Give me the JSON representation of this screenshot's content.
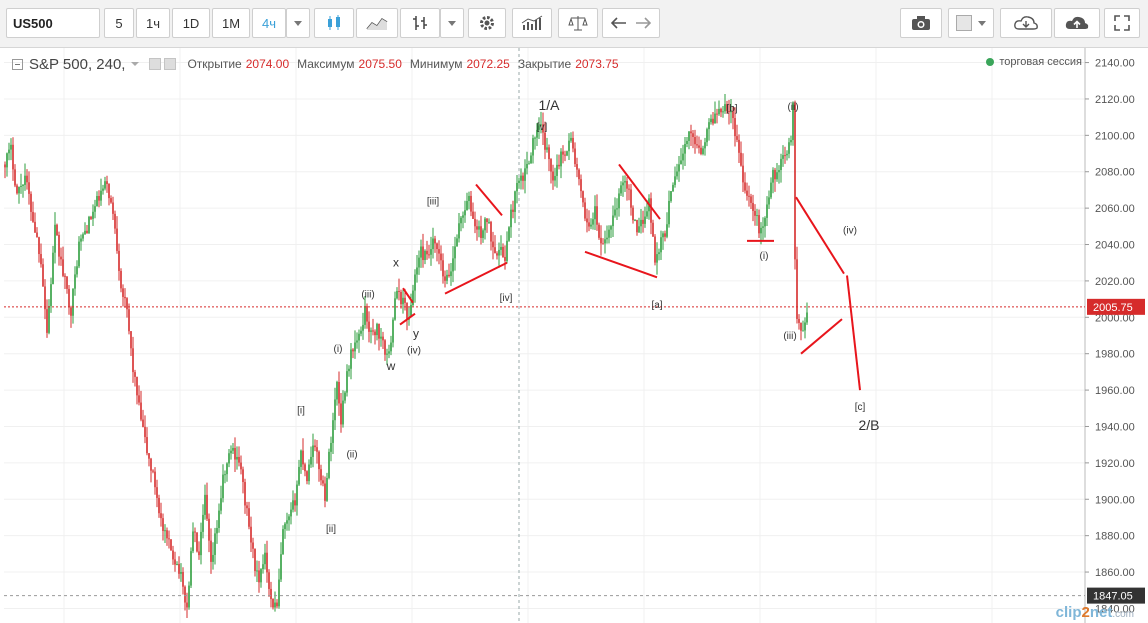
{
  "toolbar": {
    "symbol": "US500",
    "intervals": [
      "5",
      "1ч",
      "1D",
      "1M",
      "4ч"
    ],
    "active_interval": "4ч",
    "icons": [
      "interval-caret-icon",
      "candles-icon",
      "area-icon",
      "bars-icon",
      "chart-type-caret-icon",
      "gear-icon",
      "indicators-icon",
      "compare-scales-icon",
      "undo-icon",
      "redo-icon",
      "camera-icon",
      "color-square-icon",
      "cloud-download-icon",
      "cloud-upload-icon",
      "fullscreen-icon"
    ]
  },
  "legend": {
    "title": "S&P 500, 240,",
    "open_label": "Открытие",
    "open": "2074.00",
    "high_label": "Максимум",
    "high": "2075.50",
    "low_label": "Минимум",
    "low": "2072.25",
    "close_label": "Закрытие",
    "close": "2073.75",
    "session": "торговая сессия"
  },
  "watermark": {
    "a": "clip",
    "b": "2",
    "c": "net",
    "d": ".com"
  },
  "colors": {
    "up": "#2e9e3e",
    "down": "#d62b2b",
    "annotation": "#e8151c",
    "axis": "#555555",
    "grid": "#f0f0f0"
  },
  "chart_data": {
    "type": "candlestick",
    "symbol": "S&P 500",
    "ylim": [
      1832,
      2148
    ],
    "y_ticks": [
      1840,
      1860,
      1880,
      1900,
      1920,
      1940,
      1960,
      1980,
      2000,
      2020,
      2040,
      2060,
      2080,
      2100,
      2120,
      2140
    ],
    "last_price": "2005.75",
    "level_marker": "1847.05",
    "price_path": [
      [
        0,
        2084
      ],
      [
        8,
        2092
      ],
      [
        14,
        2068
      ],
      [
        22,
        2078
      ],
      [
        30,
        2054
      ],
      [
        38,
        2032
      ],
      [
        44,
        1992
      ],
      [
        52,
        2048
      ],
      [
        60,
        2024
      ],
      [
        68,
        2004
      ],
      [
        76,
        2040
      ],
      [
        86,
        2052
      ],
      [
        96,
        2066
      ],
      [
        104,
        2074
      ],
      [
        112,
        2050
      ],
      [
        118,
        2018
      ],
      [
        124,
        2002
      ],
      [
        130,
        1972
      ],
      [
        136,
        1950
      ],
      [
        144,
        1926
      ],
      [
        152,
        1908
      ],
      [
        160,
        1882
      ],
      [
        168,
        1872
      ],
      [
        176,
        1862
      ],
      [
        184,
        1840
      ],
      [
        190,
        1884
      ],
      [
        196,
        1868
      ],
      [
        202,
        1900
      ],
      [
        208,
        1862
      ],
      [
        214,
        1886
      ],
      [
        220,
        1910
      ],
      [
        228,
        1928
      ],
      [
        236,
        1922
      ],
      [
        244,
        1892
      ],
      [
        250,
        1870
      ],
      [
        256,
        1852
      ],
      [
        262,
        1872
      ],
      [
        268,
        1844
      ],
      [
        274,
        1840
      ],
      [
        280,
        1882
      ],
      [
        286,
        1888
      ],
      [
        292,
        1900
      ],
      [
        298,
        1926
      ],
      [
        304,
        1912
      ],
      [
        310,
        1932
      ],
      [
        316,
        1918
      ],
      [
        322,
        1902
      ],
      [
        328,
        1934
      ],
      [
        334,
        1964
      ],
      [
        338,
        1944
      ],
      [
        344,
        1970
      ],
      [
        350,
        1984
      ],
      [
        356,
        1988
      ],
      [
        362,
        2004
      ],
      [
        368,
        1990
      ],
      [
        374,
        1994
      ],
      [
        380,
        1984
      ],
      [
        386,
        1978
      ],
      [
        392,
        2012
      ],
      [
        400,
        2010
      ],
      [
        406,
        1998
      ],
      [
        412,
        2024
      ],
      [
        418,
        2036
      ],
      [
        424,
        2032
      ],
      [
        430,
        2040
      ],
      [
        436,
        2034
      ],
      [
        442,
        2018
      ],
      [
        448,
        2026
      ],
      [
        454,
        2046
      ],
      [
        460,
        2058
      ],
      [
        466,
        2064
      ],
      [
        472,
        2050
      ],
      [
        478,
        2046
      ],
      [
        484,
        2054
      ],
      [
        490,
        2040
      ],
      [
        496,
        2036
      ],
      [
        502,
        2034
      ],
      [
        508,
        2056
      ],
      [
        514,
        2072
      ],
      [
        520,
        2076
      ],
      [
        526,
        2088
      ],
      [
        532,
        2100
      ],
      [
        538,
        2104
      ],
      [
        544,
        2090
      ],
      [
        550,
        2078
      ],
      [
        556,
        2086
      ],
      [
        562,
        2092
      ],
      [
        568,
        2098
      ],
      [
        574,
        2080
      ],
      [
        580,
        2060
      ],
      [
        586,
        2050
      ],
      [
        592,
        2058
      ],
      [
        598,
        2038
      ],
      [
        604,
        2044
      ],
      [
        610,
        2056
      ],
      [
        616,
        2066
      ],
      [
        622,
        2078
      ],
      [
        628,
        2062
      ],
      [
        634,
        2044
      ],
      [
        640,
        2054
      ],
      [
        646,
        2064
      ],
      [
        652,
        2032
      ],
      [
        658,
        2042
      ],
      [
        664,
        2050
      ],
      [
        668,
        2072
      ],
      [
        674,
        2082
      ],
      [
        680,
        2090
      ],
      [
        686,
        2100
      ],
      [
        692,
        2098
      ],
      [
        698,
        2092
      ],
      [
        704,
        2102
      ],
      [
        710,
        2110
      ],
      [
        716,
        2114
      ],
      [
        722,
        2118
      ],
      [
        728,
        2112
      ],
      [
        734,
        2098
      ],
      [
        740,
        2076
      ],
      [
        746,
        2066
      ],
      [
        752,
        2056
      ],
      [
        758,
        2046
      ],
      [
        764,
        2062
      ],
      [
        770,
        2078
      ],
      [
        776,
        2082
      ],
      [
        782,
        2088
      ],
      [
        788,
        2100
      ],
      [
        790,
        2118
      ],
      [
        792,
        2030
      ],
      [
        794,
        2000
      ],
      [
        798,
        1992
      ],
      [
        802,
        2000
      ]
    ],
    "annotation_lines": [
      [
        [
          472,
          2073
        ],
        [
          498,
          2056
        ]
      ],
      [
        [
          441,
          2013
        ],
        [
          503,
          2030
        ]
      ],
      [
        [
          399,
          2016
        ],
        [
          409,
          2008
        ]
      ],
      [
        [
          396,
          1996
        ],
        [
          411,
          2002
        ]
      ],
      [
        [
          615,
          2084
        ],
        [
          656,
          2054
        ]
      ],
      [
        [
          581,
          2036
        ],
        [
          653,
          2022
        ]
      ],
      [
        [
          743,
          2042
        ],
        [
          770,
          2042
        ]
      ],
      [
        [
          792,
          2066
        ],
        [
          840,
          2024
        ]
      ],
      [
        [
          797,
          1980
        ],
        [
          838,
          1999
        ]
      ],
      [
        [
          843,
          2023
        ],
        [
          856,
          1960
        ]
      ]
    ],
    "vertical_markers": [
      515
    ],
    "wave_labels": [
      {
        "text": "1/A",
        "x": 545,
        "y": 2114,
        "size": "large"
      },
      {
        "text": "[v]",
        "x": 538,
        "y": 2103,
        "size": "small"
      },
      {
        "text": "[b]",
        "x": 728,
        "y": 2113,
        "size": "small"
      },
      {
        "text": "(ii)",
        "x": 789,
        "y": 2114,
        "size": "small"
      },
      {
        "text": "[iii]",
        "x": 429,
        "y": 2062,
        "size": "small"
      },
      {
        "text": "x",
        "x": 392,
        "y": 2028,
        "size": "medium"
      },
      {
        "text": "(iii)",
        "x": 364,
        "y": 2011,
        "size": "small"
      },
      {
        "text": "[iv]",
        "x": 502,
        "y": 2009,
        "size": "small"
      },
      {
        "text": "y",
        "x": 412,
        "y": 1989,
        "size": "medium"
      },
      {
        "text": "(iv)",
        "x": 410,
        "y": 1980,
        "size": "small"
      },
      {
        "text": "(i)",
        "x": 334,
        "y": 1981,
        "size": "small"
      },
      {
        "text": "w",
        "x": 387,
        "y": 1971,
        "size": "medium"
      },
      {
        "text": "[i]",
        "x": 297,
        "y": 1947,
        "size": "small"
      },
      {
        "text": "(ii)",
        "x": 348,
        "y": 1923,
        "size": "small"
      },
      {
        "text": "[ii]",
        "x": 327,
        "y": 1882,
        "size": "small"
      },
      {
        "text": "[a]",
        "x": 653,
        "y": 2005,
        "size": "small"
      },
      {
        "text": "(i)",
        "x": 760,
        "y": 2032,
        "size": "small"
      },
      {
        "text": "(iv)",
        "x": 846,
        "y": 2046,
        "size": "small"
      },
      {
        "text": "(iii)",
        "x": 786,
        "y": 1988,
        "size": "small"
      },
      {
        "text": "[c]",
        "x": 856,
        "y": 1949,
        "size": "small"
      },
      {
        "text": "2/B",
        "x": 865,
        "y": 1938,
        "size": "large"
      }
    ]
  }
}
